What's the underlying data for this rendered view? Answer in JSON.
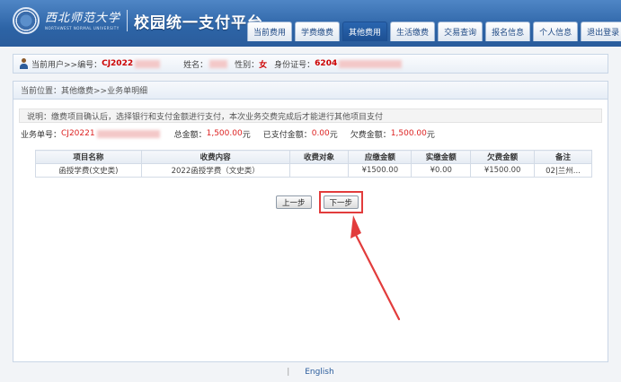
{
  "header": {
    "school_cn": "西北师范大学",
    "school_en": "NORTHWEST NORMAL UNIVERSITY",
    "platform_title": "校园统一支付平台",
    "nav": [
      "当前费用",
      "学费缴费",
      "其他费用",
      "生活缴费",
      "交易查询",
      "报名信息",
      "个人信息",
      "退出登录"
    ],
    "active_index": 2
  },
  "infobar": {
    "current_user_label": "当前用户>>编号：",
    "user_id": "CJ2022",
    "name_label": "姓名：",
    "gender_label": "性别：",
    "gender": "女",
    "id_label": "身份证号：",
    "id_value": "6204"
  },
  "breadcrumb": "当前位置：其他缴费>>业务单明细",
  "note": "说明：缴费项目确认后，选择银行和支付金额进行支付，本次业务交费完成后才能进行其他项目支付",
  "summary": {
    "order_label": "业务单号：",
    "order_value": "CJ20221",
    "total_label": "总金额：",
    "total_value": "1,500.00",
    "paid_label": "已支付金额：",
    "paid_value": "0.00",
    "owed_label": "欠费金额：",
    "owed_value": "1,500.00",
    "unit": "元"
  },
  "table": {
    "headers": [
      "项目名称",
      "收费内容",
      "收费对象",
      "应缴金额",
      "实缴金额",
      "欠费金额",
      "备注"
    ],
    "rows": [
      [
        "函授学费(文史类)",
        "2022函授学费（文史类）",
        "",
        "¥1500.00",
        "¥0.00",
        "¥1500.00",
        "02|兰州..."
      ]
    ]
  },
  "buttons": {
    "prev": "上一步",
    "next": "下一步"
  },
  "footer": {
    "divider": "|",
    "lang": "English"
  },
  "colors": {
    "header_blue": "#2d64a6",
    "highlight_red": "#e23c3c",
    "value_red": "#cc0000"
  }
}
